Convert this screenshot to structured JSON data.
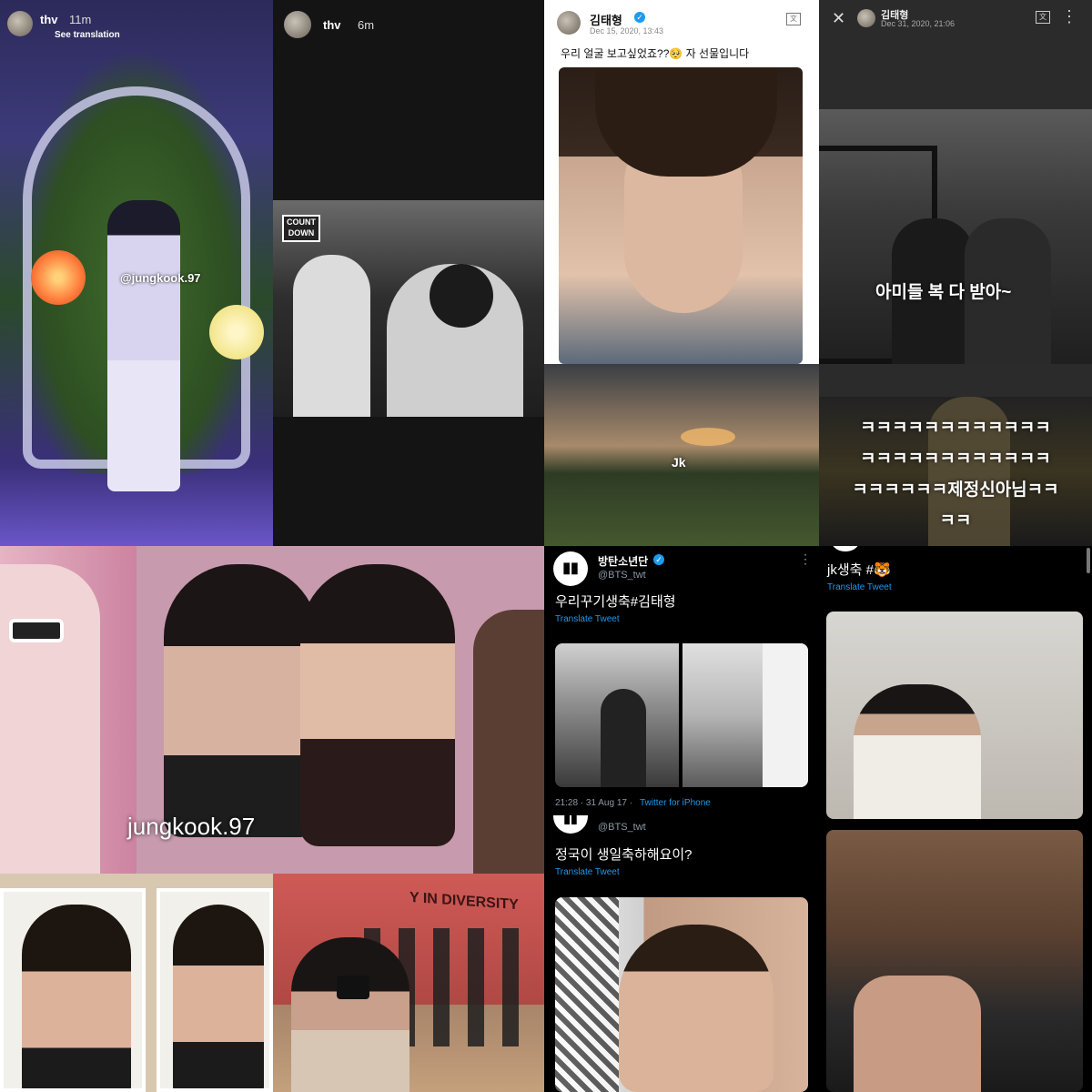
{
  "story1": {
    "user": "thv",
    "time": "11m",
    "see_translation": "See translation",
    "mention": "@jungkook.97"
  },
  "story2": {
    "user": "thv",
    "time": "6m",
    "logo_line1": "COUNT",
    "logo_line2": "DOWN"
  },
  "tweet_kth1": {
    "name": "김태형",
    "date": "Dec 15, 2020, 13:43",
    "text": "우리 얼굴 보고싶었죠??🥺 자 선물입니다"
  },
  "jk_tile": {
    "label": "Jk"
  },
  "tweet_kth2": {
    "name": "김태형",
    "date": "Dec 31, 2020, 21:06",
    "caption": "아미들 복 다 받아~"
  },
  "laugh_tile": {
    "line1": "ㅋㅋㅋㅋㅋㅋㅋㅋㅋㅋㅋㅋ",
    "line2": "ㅋㅋㅋㅋㅋㅋㅋㅋㅋㅋㅋㅋ",
    "line3": "ㅋㅋㅋㅋㅋㅋ제정신아님ㅋㅋ",
    "line4": "ㅋㅋ"
  },
  "photobooth": {
    "label": "jungkook.97"
  },
  "dance_tile": {
    "wall_text": "Y IN DIVERSITY"
  },
  "tweet_bts1": {
    "name": "방탄소년단",
    "handle": "@BTS_twt",
    "text": "우리꾸기생축#김태형",
    "translate": "Translate Tweet",
    "meta_time": "21:28 · 31 Aug 17 · ",
    "meta_source": "Twitter for iPhone",
    "more": "⋮"
  },
  "tweet_bts2": {
    "handle": "@BTS_twt",
    "text": "정국이 생일축하해요이?",
    "translate": "Translate Tweet"
  },
  "tweet_jk": {
    "text": "jk생축 #🐯",
    "translate": "Translate Tweet"
  },
  "colors": {
    "twitter_blue": "#1d9bf0",
    "dark_bg": "#000000",
    "story_dark": "#141414"
  }
}
